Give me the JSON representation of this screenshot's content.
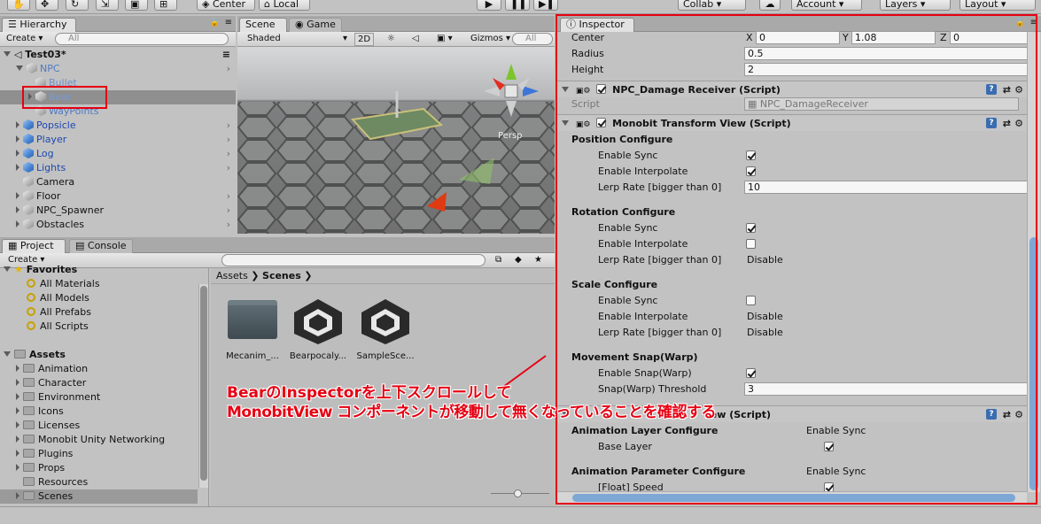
{
  "toolbar": {
    "center": "Center",
    "local": "Local",
    "collab": "Collab",
    "account": "Account",
    "layers": "Layers",
    "layout": "Layout"
  },
  "hierarchy": {
    "tab": "Hierarchy",
    "create": "Create",
    "search_placeholder": "All",
    "scene": "Test03*",
    "items": [
      {
        "label": "NPC",
        "indent": 1,
        "fold": "open",
        "color": "#4f79c4",
        "icon": "cube-gray-icon"
      },
      {
        "label": "Bullet",
        "indent": 2,
        "fold": "",
        "color": "#6f8fc8",
        "icon": "cube-gray-icon"
      },
      {
        "label": "Bear",
        "indent": 2,
        "fold": "closed",
        "color": "#7a9ad0",
        "icon": "cube-gray-icon",
        "selected": true
      },
      {
        "label": "WayPoints",
        "indent": 2,
        "fold": "",
        "color": "#4f79c4",
        "icon": "cube-gray-icon"
      },
      {
        "label": "Popsicle",
        "indent": 1,
        "fold": "closed",
        "color": "#1d48b0",
        "icon": "cube-blue-icon"
      },
      {
        "label": "Player",
        "indent": 1,
        "fold": "closed",
        "color": "#1d48b0",
        "icon": "cube-blue-icon"
      },
      {
        "label": "Log",
        "indent": 1,
        "fold": "closed",
        "color": "#1d48b0",
        "icon": "cube-blue-icon"
      },
      {
        "label": "Lights",
        "indent": 1,
        "fold": "closed",
        "color": "#1d48b0",
        "icon": "cube-blue-icon"
      },
      {
        "label": "Camera",
        "indent": 1,
        "fold": "",
        "color": "#111",
        "icon": "cube-gray-icon"
      },
      {
        "label": "Floor",
        "indent": 1,
        "fold": "closed",
        "color": "#111",
        "icon": "cube-gray-icon"
      },
      {
        "label": "NPC_Spawner",
        "indent": 1,
        "fold": "closed",
        "color": "#111",
        "icon": "cube-gray-icon"
      },
      {
        "label": "Obstacles",
        "indent": 1,
        "fold": "closed",
        "color": "#111",
        "icon": "cube-gray-icon"
      }
    ]
  },
  "scene": {
    "tab_scene": "Scene",
    "tab_game": "Game",
    "shading": "Shaded",
    "mode2d": "2D",
    "gizmos": "Gizmos",
    "search_placeholder": "All",
    "persp": "Persp"
  },
  "project": {
    "tab_project": "Project",
    "tab_console": "Console",
    "create": "Create",
    "favorites_title": "Favorites",
    "favorites": [
      "All Materials",
      "All Models",
      "All Prefabs",
      "All Scripts"
    ],
    "assets_title": "Assets",
    "assets": [
      "Animation",
      "Character",
      "Environment",
      "Icons",
      "Licenses",
      "Monobit Unity Networking",
      "Plugins",
      "Props",
      "Resources",
      "Scenes"
    ],
    "breadcrumb": [
      "Assets",
      "Scenes"
    ],
    "files": [
      {
        "label": "Mecanim_...",
        "icon": "folder-icon"
      },
      {
        "label": "Bearpocaly...",
        "icon": "unity-scene-icon"
      },
      {
        "label": "SampleSce...",
        "icon": "unity-scene-icon"
      }
    ]
  },
  "inspector": {
    "tab": "Inspector",
    "center_label": "Center",
    "center": {
      "x_label": "X",
      "x": "0",
      "y_label": "Y",
      "y": "1.08",
      "z_label": "Z",
      "z": "0"
    },
    "radius_label": "Radius",
    "radius": "0.5",
    "height_label": "Height",
    "height": "2",
    "comp1": {
      "title": "NPC_Damage Receiver (Script)",
      "script_label": "Script",
      "script_value": "NPC_DamageReceiver"
    },
    "comp2": {
      "title": "Monobit Transform View (Script)",
      "pos_title": "Position Configure",
      "pos_sync": "Enable Sync",
      "pos_interp": "Enable Interpolate",
      "pos_lerp": "Lerp Rate [bigger than 0]",
      "pos_lerp_value": "10",
      "rot_title": "Rotation Configure",
      "rot_sync": "Enable Sync",
      "rot_interp": "Enable Interpolate",
      "rot_lerp": "Lerp Rate [bigger than 0]",
      "rot_lerp_value": "Disable",
      "scale_title": "Scale Configure",
      "scale_sync": "Enable Sync",
      "scale_interp": "Enable Interpolate",
      "scale_interp_value": "Disable",
      "scale_lerp": "Lerp Rate [bigger than 0]",
      "scale_lerp_value": "Disable",
      "snap_title": "Movement Snap(Warp)",
      "snap_enable": "Enable Snap(Warp)",
      "snap_threshold": "Snap(Warp) Threshold",
      "snap_value": "3"
    },
    "comp3": {
      "title_visible": "iew (Script)",
      "anim_layer_title": "Animation Layer Configure",
      "enable_sync": "Enable Sync",
      "base_layer": "Base Layer",
      "anim_param_title": "Animation Parameter Configure",
      "enable_sync2": "Enable Sync",
      "float_speed": "[Float] Speed"
    }
  },
  "annotation": {
    "line1": "BearのInspectorを上下スクロールして",
    "line2": "MonobitView コンポーネントが移動して無くなっていることを確認する",
    "color": "#e60012"
  }
}
